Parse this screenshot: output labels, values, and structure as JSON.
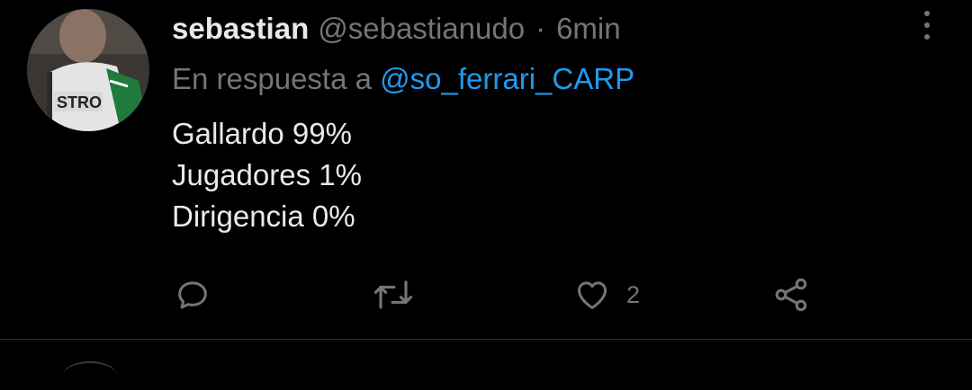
{
  "tweet": {
    "display_name": "sebastian",
    "handle": "@sebastianudo",
    "separator": "·",
    "time": "6min",
    "reply_prefix": "En respuesta a",
    "reply_to": "@so_ferrari_CARP",
    "lines": [
      "Gallardo 99%",
      "Jugadores 1%",
      "Dirigencia 0%"
    ],
    "actions": {
      "reply_icon": "comment-icon",
      "retweet_icon": "retweet-icon",
      "like_icon": "heart-icon",
      "like_count": "2",
      "share_icon": "share-icon"
    },
    "more_icon": "more-vertical-icon"
  },
  "colors": {
    "background": "#000000",
    "primary_text": "#e7e9ea",
    "secondary_text": "#71767b",
    "accent": "#1d9bf0",
    "divider": "#2f3336"
  }
}
